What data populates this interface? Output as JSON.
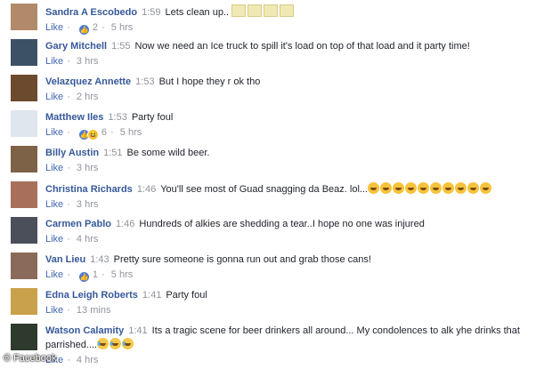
{
  "comments": [
    {
      "name": "Sandra A Escobedo",
      "time": "1:59",
      "text": "Lets clean up..",
      "like": "Like",
      "reacts": "2",
      "ago": "5 hrs",
      "avatar_color": "#b08a6a"
    },
    {
      "name": "Gary Mitchell",
      "time": "1:55",
      "text": "Now we need an Ice truck to spill it's load on top of that load and it party time!",
      "like": "Like",
      "ago": "3 hrs",
      "avatar_color": "#3d5166"
    },
    {
      "name": "Velazquez Annette",
      "time": "1:53",
      "text": "But I hope they r ok tho",
      "like": "Like",
      "ago": "2 hrs",
      "avatar_color": "#6b4a2e"
    },
    {
      "name": "Matthew Iles",
      "time": "1:53",
      "text": "Party foul",
      "like": "Like",
      "reacts": "6",
      "ago": "5 hrs",
      "avatar_color": "#dfe6ee"
    },
    {
      "name": "Billy Austin",
      "time": "1:51",
      "text": "Be some wild beer.",
      "like": "Like",
      "ago": "3 hrs",
      "avatar_color": "#7d6248"
    },
    {
      "name": "Christina Richards",
      "time": "1:46",
      "text": "You'll see most of Guad snagging da Beaz. lol...",
      "like": "Like",
      "ago": "3 hrs",
      "avatar_color": "#a8705a"
    },
    {
      "name": "Carmen Pablo",
      "time": "1:46",
      "text": "Hundreds of alkies are shedding a tear..I hope no one was injured",
      "like": "Like",
      "ago": "4 hrs",
      "avatar_color": "#4a4f5a"
    },
    {
      "name": "Van Lieu",
      "time": "1:43",
      "text": "Pretty sure someone is gonna run out and grab those cans!",
      "like": "Like",
      "reacts": "1",
      "ago": "5 hrs",
      "avatar_color": "#8a6a5a"
    },
    {
      "name": "Edna Leigh Roberts",
      "time": "1:41",
      "text": "Party foul",
      "like": "Like",
      "ago": "13 mins",
      "avatar_color": "#c9a14a"
    },
    {
      "name": "Watson Calamity",
      "time": "1:41",
      "text": "Its a tragic scene for beer drinkers all around... My condolences to alk yhe drinks that parrished....",
      "like": "Like",
      "ago": "4 hrs",
      "avatar_color": "#2e3a2e"
    }
  ],
  "watermark": "© Facebook"
}
